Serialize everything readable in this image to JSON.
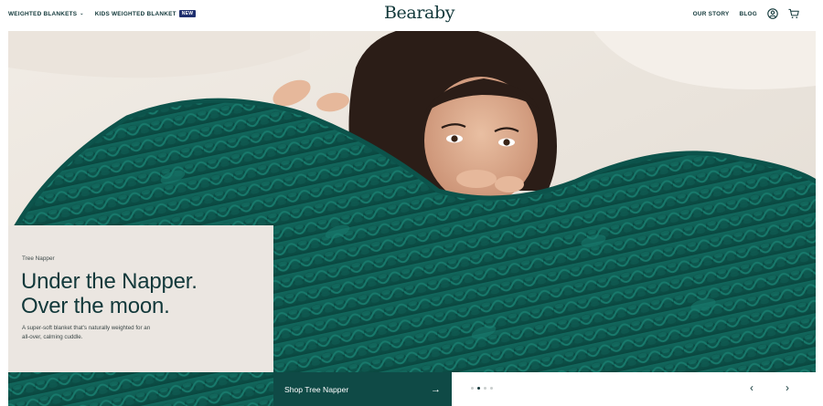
{
  "header": {
    "nav_left": [
      {
        "label": "WEIGHTED BLANKETS",
        "has_caret": true
      },
      {
        "label": "KIDS WEIGHTED BLANKET",
        "badge": "NEW"
      }
    ],
    "logo": "Bearaby",
    "nav_right": [
      {
        "label": "OUR STORY"
      },
      {
        "label": "BLOG"
      }
    ],
    "icons": [
      "account-icon",
      "cart-icon"
    ]
  },
  "hero": {
    "eyebrow": "Tree Napper",
    "headline_line1": "Under the Napper.",
    "headline_line2": "Over the moon.",
    "subcopy": "A super-soft blanket that's naturally weighted for an all-over, calming cuddle.",
    "cta_label": "Shop Tree Napper",
    "slide_count": 4,
    "active_slide": 2
  },
  "colors": {
    "brand": "#12383a",
    "cta_bg": "#0f4a46",
    "blanket": "#0e5c52",
    "panel_bg": "#ebe6e1",
    "badge_bg": "#1f2f6e"
  }
}
